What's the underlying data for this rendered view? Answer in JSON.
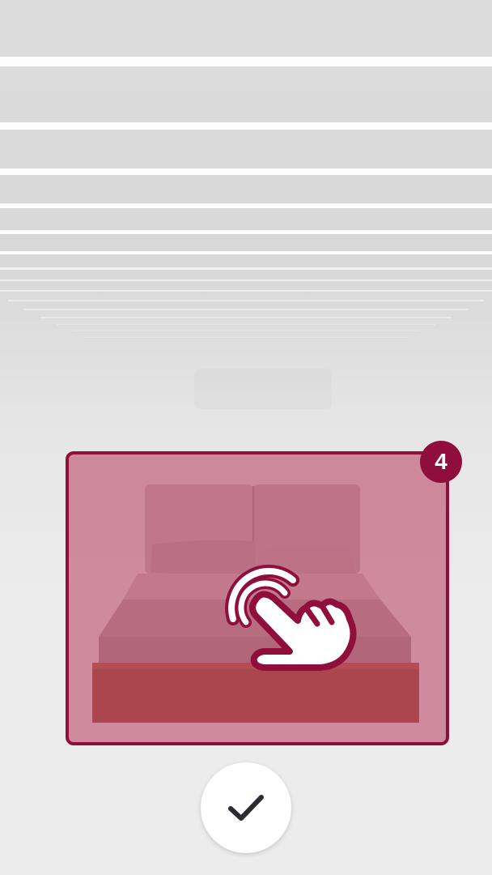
{
  "tutorial": {
    "step_number": "4"
  },
  "colors": {
    "accent": "#8f0e3c",
    "highlight_fill": "rgba(175, 20, 65, 0.45)",
    "button_bg": "#ffffff",
    "checkmark": "#2b2b33"
  },
  "icons": {
    "gesture": "tap-hand-icon",
    "confirm": "checkmark-icon"
  }
}
